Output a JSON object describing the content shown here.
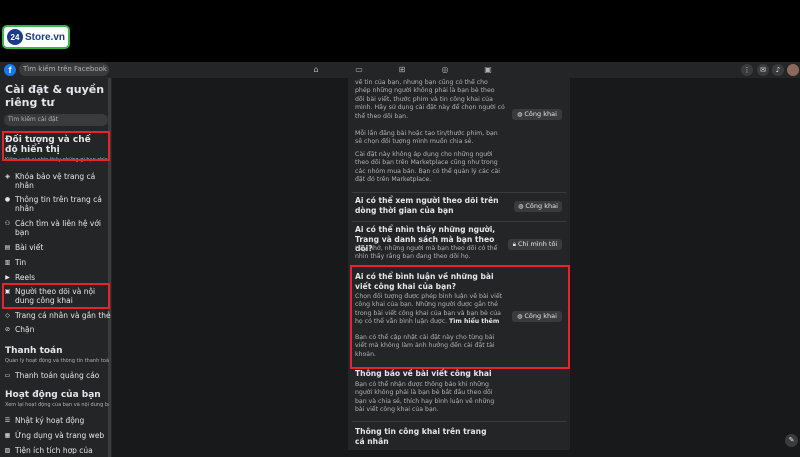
{
  "watermark": {
    "badge": "24",
    "text": "Store.vn"
  },
  "topbar": {
    "fb_letter": "f",
    "search_placeholder": "Tìm kiếm trên Facebook",
    "notification_count": "1"
  },
  "sidebar": {
    "title": "Cài đặt & quyền riêng tư",
    "search_placeholder": "Tìm kiếm cài đặt",
    "section_audience": {
      "title": "Đối tượng và chế độ hiển thị",
      "subtitle": "Kiểm soát ai nhìn thấy những gì bạn chia sẻ"
    },
    "audience_items": [
      {
        "label": "Khóa bảo vệ trang cá nhân",
        "icon": "shield-icon"
      },
      {
        "label": "Thông tin trên trang cá nhân",
        "icon": "person-icon"
      },
      {
        "label": "Cách tìm và liên hệ với bạn",
        "icon": "people-icon"
      },
      {
        "label": "Bài viết",
        "icon": "post-icon"
      },
      {
        "label": "Tin",
        "icon": "story-icon"
      },
      {
        "label": "Reels",
        "icon": "reels-icon"
      },
      {
        "label": "Người theo dõi và nội dung công khai",
        "icon": "followers-icon"
      },
      {
        "label": "Trang cá nhân và gắn thẻ",
        "icon": "tag-icon"
      },
      {
        "label": "Chặn",
        "icon": "block-icon"
      }
    ],
    "section_payments": {
      "title": "Thanh toán",
      "subtitle": "Quản lý hoạt động và thông tin thanh toán"
    },
    "payments_items": [
      {
        "label": "Thanh toán quảng cáo",
        "icon": "card-icon"
      }
    ],
    "section_activity": {
      "title": "Hoạt động của bạn",
      "subtitle": "Xem lại hoạt động của bạn và nội dung bạn được gắn thẻ"
    },
    "activity_items": [
      {
        "label": "Nhật ký hoạt động",
        "icon": "list-icon"
      },
      {
        "label": "Ứng dụng và trang web",
        "icon": "apps-icon"
      },
      {
        "label": "Tiện ích tích hợp của doanh nghiệp",
        "icon": "business-icon"
      }
    ]
  },
  "panel": {
    "section1_text": "về tin của bạn, nhưng bạn cũng có thể cho phép những người không phải là bạn bè theo dõi bài viết, thước phim và tin công khai của mình. Hãy sử dụng cài đặt này để chọn người có thể theo dõi bạn.",
    "section1_extra": "Mỗi lần đăng bài hoặc tạo tin/thước phim, bạn sẽ chọn đối tượng mình muốn chia sẻ.",
    "section1_extra2": "Cài đặt này không áp dụng cho những người theo dõi bạn trên Marketplace cũng như trong các nhóm mua bán. Bạn có thể quản lý các cài đặt đó trên Marketplace.",
    "section1_value": "Công khai",
    "section2_title": "Ai có thể xem người theo dõi trên dòng thời gian của bạn",
    "section2_value": "Công khai",
    "section3_title": "Ai có thể nhìn thấy những người, Trang và danh sách mà bạn theo dõi?",
    "section3_text": "Hãy nhớ, những người mà bạn theo dõi có thể nhìn thấy rằng bạn đang theo dõi họ.",
    "section3_value": "Chỉ mình tôi",
    "section4_title": "Ai có thể bình luận về những bài viết công khai của bạn?",
    "section4_text": "Chọn đối tượng được phép bình luận về bài viết công khai của bạn. Những người được gắn thẻ trong bài viết công khai của bạn và bạn bè của họ có thể vẫn bình luận được.",
    "section4_link": "Tìm hiểu thêm",
    "section4_text2": "Bạn có thể cập nhật cài đặt này cho từng bài viết mà không làm ảnh hưởng đến cài đặt tài khoản.",
    "section4_value": "Công khai",
    "section5_title": "Thông báo về bài viết công khai",
    "section5_text": "Bạn có thể nhận được thông báo khi những người không phải là bạn bè bắt đầu theo dõi bạn và chia sẻ, thích hay bình luận về những bài viết công khai của bạn.",
    "section6_title": "Thông tin công khai trên trang cá nhân"
  }
}
